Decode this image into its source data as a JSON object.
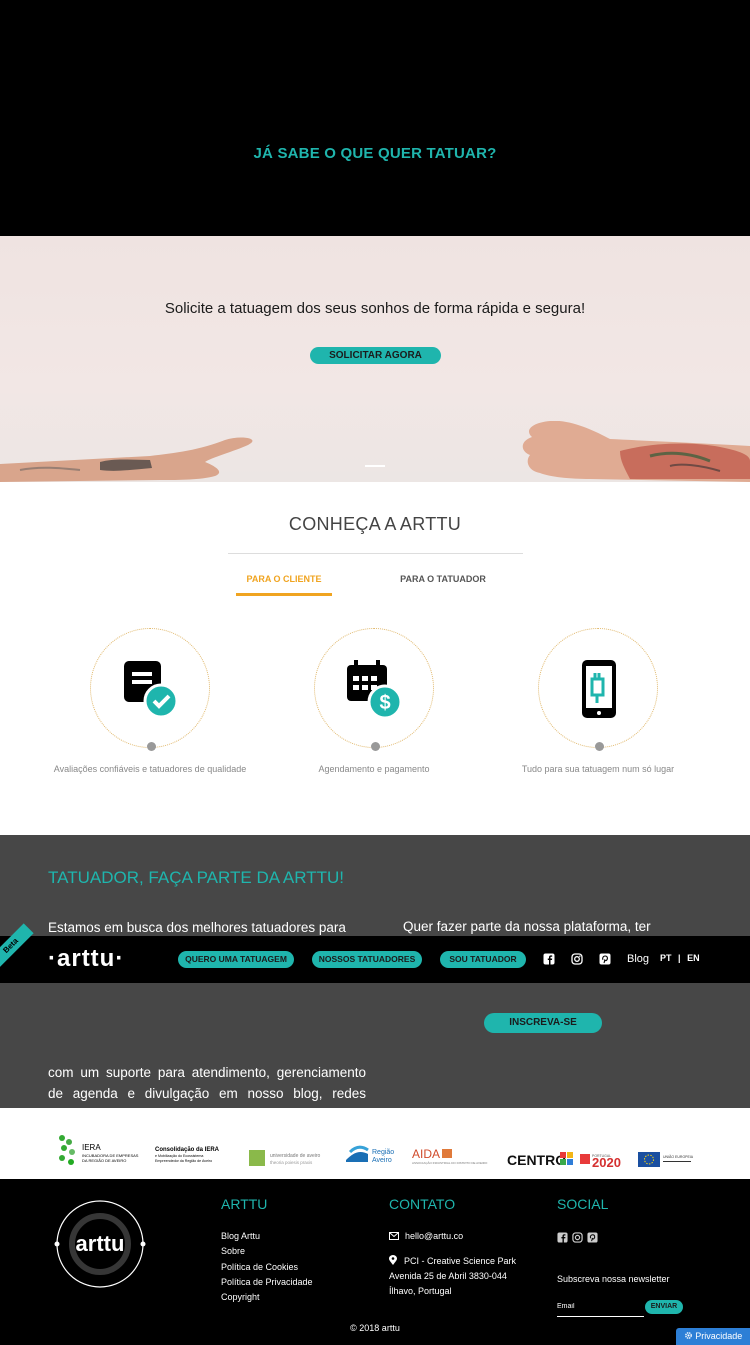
{
  "top": {
    "question": "JÁ SABE O QUE QUER TATUAR?"
  },
  "hero": {
    "tagline": "Solicite a tatuagem dos seus sonhos de forma rápida e segura!",
    "cta": "SOLICITAR AGORA"
  },
  "about": {
    "title": "CONHEÇA A ARTTU",
    "tabs": [
      {
        "label": "PARA O CLIENTE",
        "active": true
      },
      {
        "label": "PARA O TATUADOR",
        "active": false
      }
    ],
    "features": [
      {
        "icon": "review-check-icon",
        "caption": "Avaliações confiáveis e tatuadores de qualidade"
      },
      {
        "icon": "calendar-payment-icon",
        "caption": "Agendamento e pagamento"
      },
      {
        "icon": "phone-tattoo-machine-icon",
        "caption": "Tudo para sua tatuagem num só lugar"
      }
    ]
  },
  "tattooer": {
    "title": "TATUADOR, FAÇA PARTE DA ARTTU!",
    "left_line1": "Estamos em busca dos melhores tatuadores para",
    "left_rest": "com um suporte para atendimento, gerenciamento de agenda e divulgação em nosso blog, redes sociais e muito mais!",
    "right_line1": "Quer fazer parte da nossa plataforma, ter",
    "cta": "INSCREVA-SE"
  },
  "navbar": {
    "beta": "Beta",
    "logo": "arttu",
    "buttons": [
      "QUERO UMA TATUAGEM",
      "NOSSOS TATUADORES",
      "SOU TATUADOR"
    ],
    "icons": [
      "facebook-icon",
      "instagram-icon",
      "pinterest-icon"
    ],
    "blog": "Blog",
    "lang_pt": "PT",
    "lang_sep": "|",
    "lang_en": "EN"
  },
  "partners": {
    "logos": [
      {
        "name": "IERA",
        "sub": "INCUBADORA DE EMPRESAS DA REGIÃO DE AVEIRO"
      },
      {
        "name": "Consolidação da IERA",
        "sub": "e Mobilização do Ecossistema Empreendedor da Região de Aveiro"
      },
      {
        "name": "universidade de aveiro",
        "sub": "theoria poiesis praxis"
      },
      {
        "name": "Região Aveiro",
        "sub": ""
      },
      {
        "name": "AIDA",
        "sub": "ASSOCIAÇÃO INDUSTRIAL DO DISTRITO DE AVEIRO"
      },
      {
        "name": "CENTRO 2020",
        "sub": ""
      },
      {
        "name": "PORTUGAL 2020",
        "sub": ""
      },
      {
        "name": "UNIÃO EUROPEIA",
        "sub": ""
      }
    ]
  },
  "footer": {
    "logo": "arttu",
    "col1_title": "ARTTU",
    "links": [
      "Blog Arttu",
      "Sobre",
      "Política de Cookies",
      "Política de Privacidade",
      "Copyright"
    ],
    "col2_title": "CONTATO",
    "email": "hello@arttu.co",
    "address1": "PCI - Creative Science Park",
    "address2": "Avenida 25 de Abril 3830-044",
    "address3": "Ílhavo, Portugal",
    "col3_title": "SOCIAL",
    "newsletter": "Subscreva nossa newsletter",
    "email_placeholder": "Email",
    "send": "ENVIAR",
    "copyright": "© 2018 arttu"
  },
  "privacy": "Privacidade",
  "colors": {
    "teal": "#1fb5ad",
    "orange": "#f0a420",
    "dark": "#474747"
  }
}
